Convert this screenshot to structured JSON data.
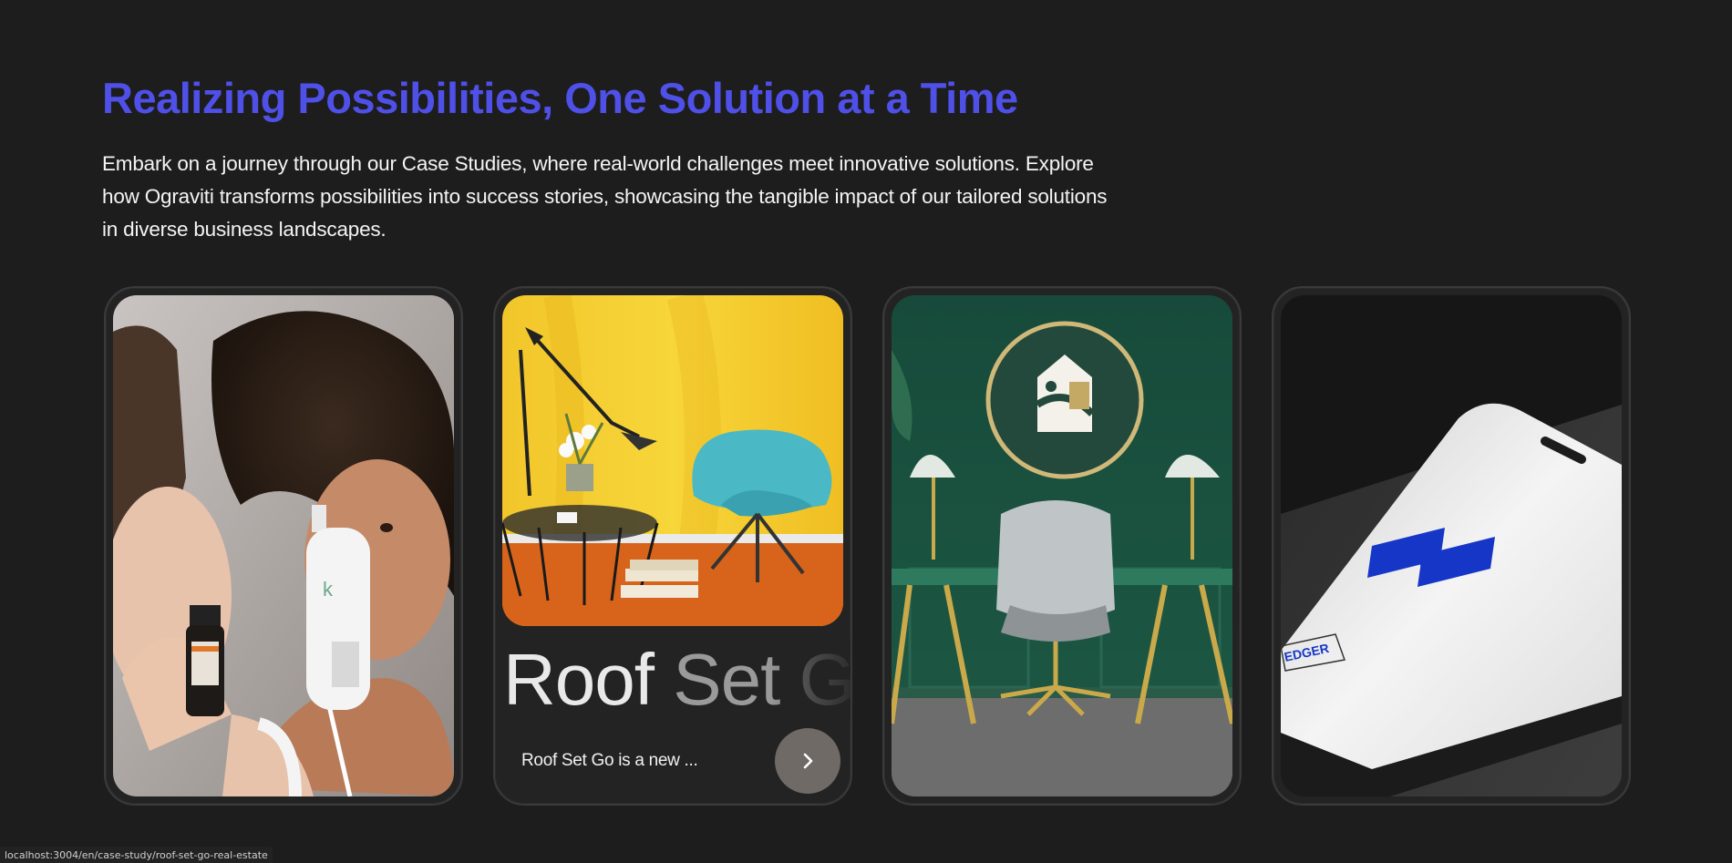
{
  "section": {
    "title": "Realizing Possibilities, One Solution at a Time",
    "description": "Embark on a journey through our Case Studies, where real-world challenges meet innovative solutions. Explore how Ograviti transforms possibilities into success stories, showcasing the tangible impact of our tailored solutions in diverse business landscapes."
  },
  "cards": [
    {
      "image": "skincare-products-photo"
    },
    {
      "image": "yellow-room-chair-photo",
      "title_word1": "Roof",
      "title_word2": "Set",
      "title_word3": "Go",
      "excerpt": "Roof Set Go is a new ...",
      "button_icon": "chevron-right-icon"
    },
    {
      "image": "green-office-logo-photo"
    },
    {
      "image": "phone-app-logo-photo"
    }
  ],
  "status_bar": {
    "url": "localhost:3004/en/case-study/roof-set-go-real-estate"
  },
  "colors": {
    "accent": "#4f50e8",
    "background": "#1d1d1d",
    "card": "#232323",
    "button": "#706a66"
  }
}
